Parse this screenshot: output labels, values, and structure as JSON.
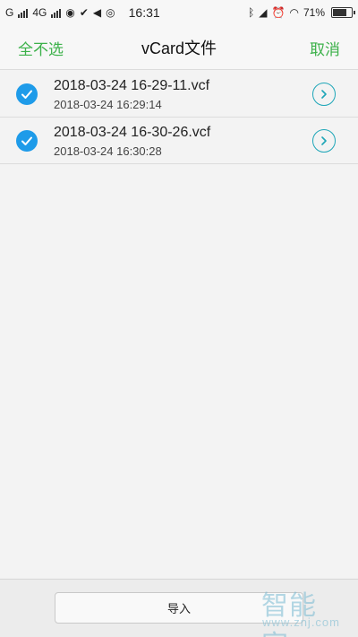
{
  "status_bar": {
    "carrier1": "G",
    "carrier2": "4G",
    "time": "16:31",
    "battery": "71%"
  },
  "header": {
    "left_label": "全不选",
    "title": "vCard文件",
    "right_label": "取消"
  },
  "files": [
    {
      "name": "2018-03-24 16-29-11.vcf",
      "date": "2018-03-24 16:29:14",
      "checked": true
    },
    {
      "name": "2018-03-24 16-30-26.vcf",
      "date": "2018-03-24 16:30:28",
      "checked": true
    }
  ],
  "bottom": {
    "import_label": "导入"
  },
  "watermark": {
    "text": "智能家",
    "url": "www.znj.com"
  },
  "colors": {
    "accent_green": "#3cb14a",
    "check_blue": "#1e9be9",
    "chevron_teal": "#1ea6b8"
  }
}
